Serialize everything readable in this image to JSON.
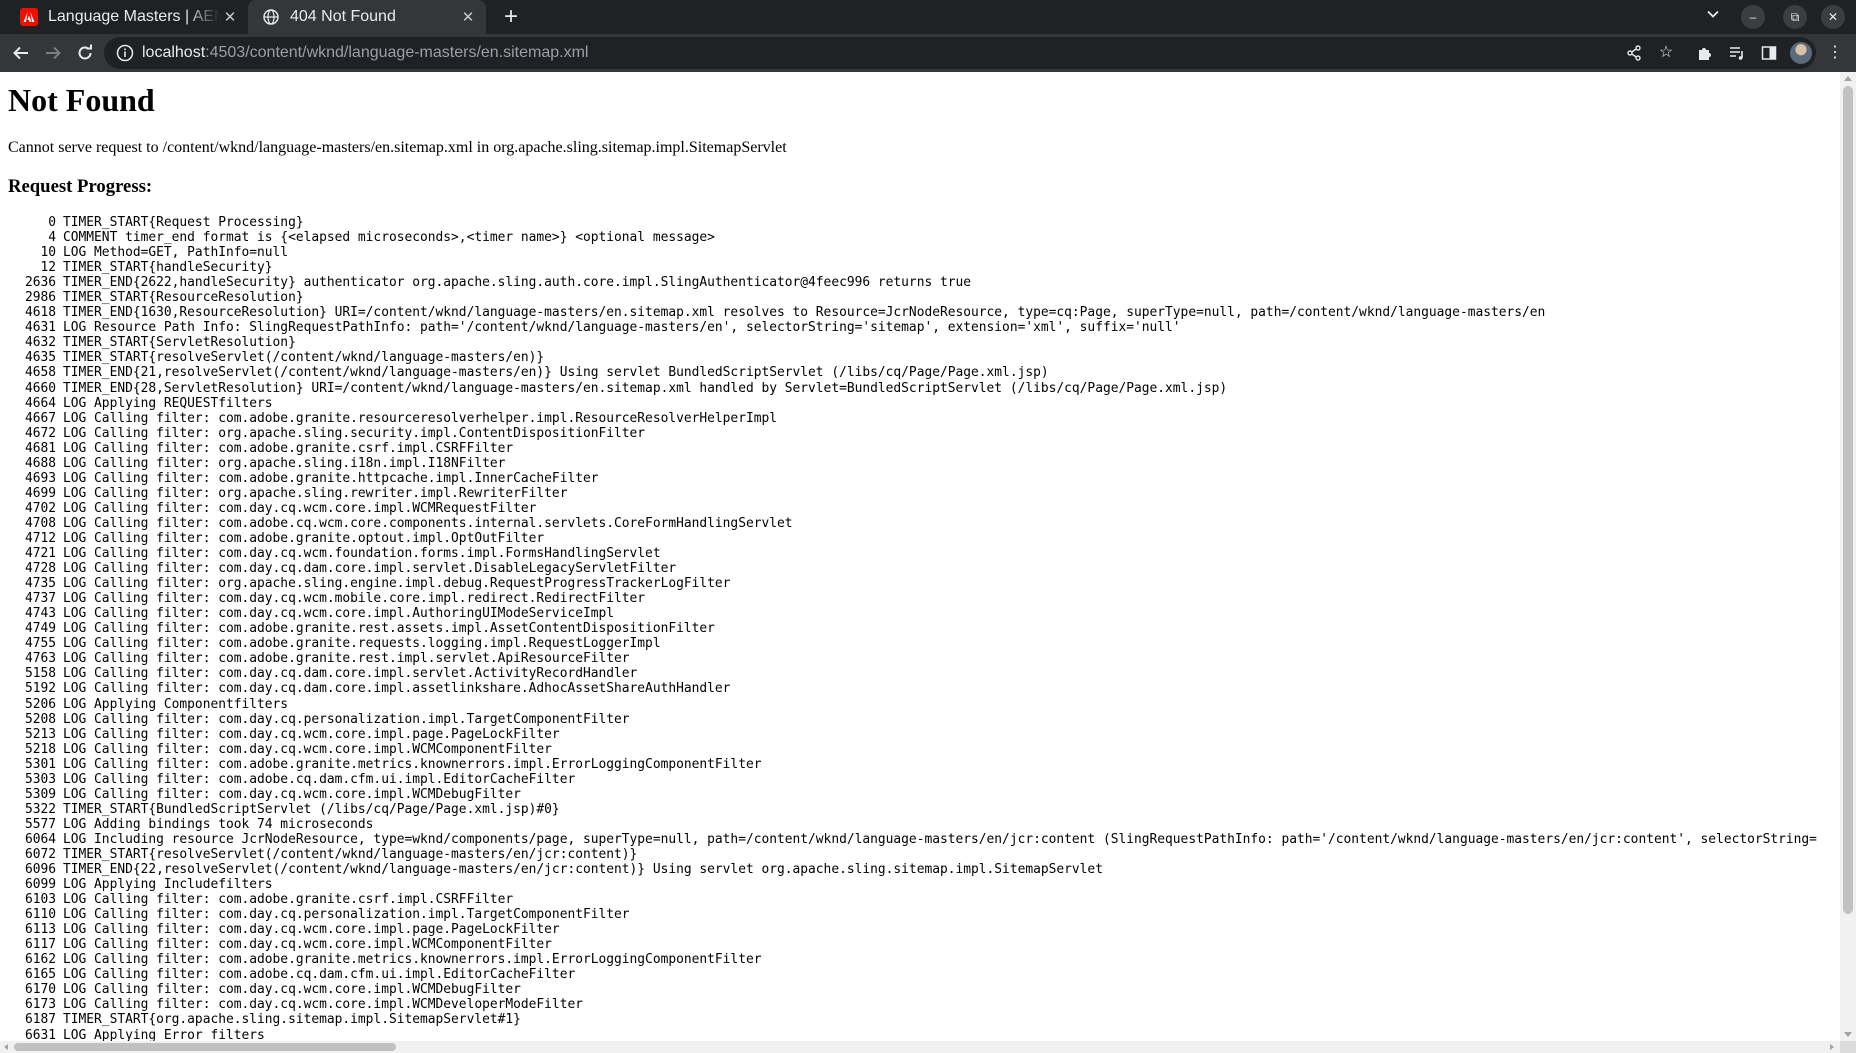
{
  "browser": {
    "tabs": [
      {
        "title": "Language Masters | AEM Sites",
        "favicon": "adobe-icon",
        "active": false
      },
      {
        "title": "404 Not Found",
        "favicon": "globe-icon",
        "active": true
      }
    ],
    "address": {
      "host": "localhost",
      "path": ":4503/content/wknd/language-masters/en.sitemap.xml"
    },
    "colors": {
      "titlebar": "#202124",
      "toolbar": "#35363a",
      "omnibox": "#202124",
      "adobe_red": "#eb1000"
    }
  },
  "page": {
    "heading": "Not Found",
    "message": "Cannot serve request to /content/wknd/language-masters/en.sitemap.xml in org.apache.sling.sitemap.impl.SitemapServlet",
    "progress_heading": "Request Progress:",
    "log": [
      {
        "t": "0",
        "text": "TIMER_START{Request Processing}"
      },
      {
        "t": "4",
        "text": "COMMENT timer_end format is {<elapsed microseconds>,<timer name>} <optional message>"
      },
      {
        "t": "10",
        "text": "LOG Method=GET, PathInfo=null"
      },
      {
        "t": "12",
        "text": "TIMER_START{handleSecurity}"
      },
      {
        "t": "2636",
        "text": "TIMER_END{2622,handleSecurity} authenticator org.apache.sling.auth.core.impl.SlingAuthenticator@4feec996 returns true"
      },
      {
        "t": "2986",
        "text": "TIMER_START{ResourceResolution}"
      },
      {
        "t": "4618",
        "text": "TIMER_END{1630,ResourceResolution} URI=/content/wknd/language-masters/en.sitemap.xml resolves to Resource=JcrNodeResource, type=cq:Page, superType=null, path=/content/wknd/language-masters/en"
      },
      {
        "t": "4631",
        "text": "LOG Resource Path Info: SlingRequestPathInfo: path='/content/wknd/language-masters/en', selectorString='sitemap', extension='xml', suffix='null'"
      },
      {
        "t": "4632",
        "text": "TIMER_START{ServletResolution}"
      },
      {
        "t": "4635",
        "text": "TIMER_START{resolveServlet(/content/wknd/language-masters/en)}"
      },
      {
        "t": "4658",
        "text": "TIMER_END{21,resolveServlet(/content/wknd/language-masters/en)} Using servlet BundledScriptServlet (/libs/cq/Page/Page.xml.jsp)"
      },
      {
        "t": "4660",
        "text": "TIMER_END{28,ServletResolution} URI=/content/wknd/language-masters/en.sitemap.xml handled by Servlet=BundledScriptServlet (/libs/cq/Page/Page.xml.jsp)"
      },
      {
        "t": "4664",
        "text": "LOG Applying REQUESTfilters"
      },
      {
        "t": "4667",
        "text": "LOG Calling filter: com.adobe.granite.resourceresolverhelper.impl.ResourceResolverHelperImpl"
      },
      {
        "t": "4672",
        "text": "LOG Calling filter: org.apache.sling.security.impl.ContentDispositionFilter"
      },
      {
        "t": "4681",
        "text": "LOG Calling filter: com.adobe.granite.csrf.impl.CSRFFilter"
      },
      {
        "t": "4688",
        "text": "LOG Calling filter: org.apache.sling.i18n.impl.I18NFilter"
      },
      {
        "t": "4693",
        "text": "LOG Calling filter: com.adobe.granite.httpcache.impl.InnerCacheFilter"
      },
      {
        "t": "4699",
        "text": "LOG Calling filter: org.apache.sling.rewriter.impl.RewriterFilter"
      },
      {
        "t": "4702",
        "text": "LOG Calling filter: com.day.cq.wcm.core.impl.WCMRequestFilter"
      },
      {
        "t": "4708",
        "text": "LOG Calling filter: com.adobe.cq.wcm.core.components.internal.servlets.CoreFormHandlingServlet"
      },
      {
        "t": "4712",
        "text": "LOG Calling filter: com.adobe.granite.optout.impl.OptOutFilter"
      },
      {
        "t": "4721",
        "text": "LOG Calling filter: com.day.cq.wcm.foundation.forms.impl.FormsHandlingServlet"
      },
      {
        "t": "4728",
        "text": "LOG Calling filter: com.day.cq.dam.core.impl.servlet.DisableLegacyServletFilter"
      },
      {
        "t": "4735",
        "text": "LOG Calling filter: org.apache.sling.engine.impl.debug.RequestProgressTrackerLogFilter"
      },
      {
        "t": "4737",
        "text": "LOG Calling filter: com.day.cq.wcm.mobile.core.impl.redirect.RedirectFilter"
      },
      {
        "t": "4743",
        "text": "LOG Calling filter: com.day.cq.wcm.core.impl.AuthoringUIModeServiceImpl"
      },
      {
        "t": "4749",
        "text": "LOG Calling filter: com.adobe.granite.rest.assets.impl.AssetContentDispositionFilter"
      },
      {
        "t": "4755",
        "text": "LOG Calling filter: com.adobe.granite.requests.logging.impl.RequestLoggerImpl"
      },
      {
        "t": "4763",
        "text": "LOG Calling filter: com.adobe.granite.rest.impl.servlet.ApiResourceFilter"
      },
      {
        "t": "5158",
        "text": "LOG Calling filter: com.day.cq.dam.core.impl.servlet.ActivityRecordHandler"
      },
      {
        "t": "5192",
        "text": "LOG Calling filter: com.day.cq.dam.core.impl.assetlinkshare.AdhocAssetShareAuthHandler"
      },
      {
        "t": "5206",
        "text": "LOG Applying Componentfilters"
      },
      {
        "t": "5208",
        "text": "LOG Calling filter: com.day.cq.personalization.impl.TargetComponentFilter"
      },
      {
        "t": "5213",
        "text": "LOG Calling filter: com.day.cq.wcm.core.impl.page.PageLockFilter"
      },
      {
        "t": "5218",
        "text": "LOG Calling filter: com.day.cq.wcm.core.impl.WCMComponentFilter"
      },
      {
        "t": "5301",
        "text": "LOG Calling filter: com.adobe.granite.metrics.knownerrors.impl.ErrorLoggingComponentFilter"
      },
      {
        "t": "5303",
        "text": "LOG Calling filter: com.adobe.cq.dam.cfm.ui.impl.EditorCacheFilter"
      },
      {
        "t": "5309",
        "text": "LOG Calling filter: com.day.cq.wcm.core.impl.WCMDebugFilter"
      },
      {
        "t": "5322",
        "text": "TIMER_START{BundledScriptServlet (/libs/cq/Page/Page.xml.jsp)#0}"
      },
      {
        "t": "5577",
        "text": "LOG Adding bindings took 74 microseconds"
      },
      {
        "t": "6064",
        "text": "LOG Including resource JcrNodeResource, type=wknd/components/page, superType=null, path=/content/wknd/language-masters/en/jcr:content (SlingRequestPathInfo: path='/content/wknd/language-masters/en/jcr:content', selectorString="
      },
      {
        "t": "6072",
        "text": "TIMER_START{resolveServlet(/content/wknd/language-masters/en/jcr:content)}"
      },
      {
        "t": "6096",
        "text": "TIMER_END{22,resolveServlet(/content/wknd/language-masters/en/jcr:content)} Using servlet org.apache.sling.sitemap.impl.SitemapServlet"
      },
      {
        "t": "6099",
        "text": "LOG Applying Includefilters"
      },
      {
        "t": "6103",
        "text": "LOG Calling filter: com.adobe.granite.csrf.impl.CSRFFilter"
      },
      {
        "t": "6110",
        "text": "LOG Calling filter: com.day.cq.personalization.impl.TargetComponentFilter"
      },
      {
        "t": "6113",
        "text": "LOG Calling filter: com.day.cq.wcm.core.impl.page.PageLockFilter"
      },
      {
        "t": "6117",
        "text": "LOG Calling filter: com.day.cq.wcm.core.impl.WCMComponentFilter"
      },
      {
        "t": "6162",
        "text": "LOG Calling filter: com.adobe.granite.metrics.knownerrors.impl.ErrorLoggingComponentFilter"
      },
      {
        "t": "6165",
        "text": "LOG Calling filter: com.adobe.cq.dam.cfm.ui.impl.EditorCacheFilter"
      },
      {
        "t": "6170",
        "text": "LOG Calling filter: com.day.cq.wcm.core.impl.WCMDebugFilter"
      },
      {
        "t": "6173",
        "text": "LOG Calling filter: com.day.cq.wcm.core.impl.WCMDeveloperModeFilter"
      },
      {
        "t": "6187",
        "text": "TIMER_START{org.apache.sling.sitemap.impl.SitemapServlet#1}"
      },
      {
        "t": "6631",
        "text": "LOG Applying Error filters"
      }
    ]
  }
}
